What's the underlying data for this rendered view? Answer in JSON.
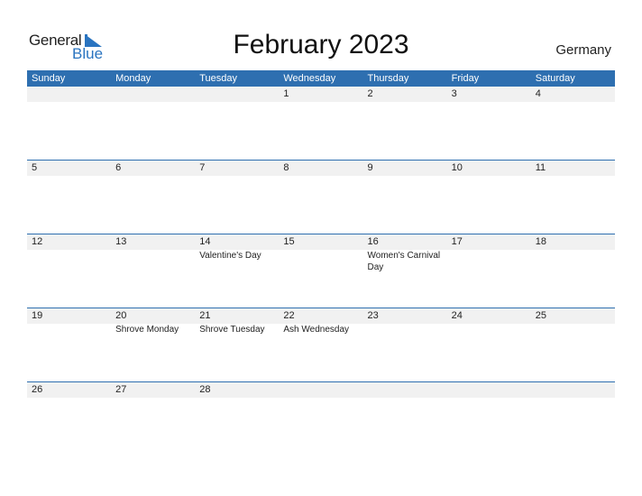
{
  "logo": {
    "word1": "General",
    "word2": "Blue",
    "brand_color": "#2a74c0"
  },
  "title": "February 2023",
  "country": "Germany",
  "header_color": "#2e6fb0",
  "weekdays": [
    "Sunday",
    "Monday",
    "Tuesday",
    "Wednesday",
    "Thursday",
    "Friday",
    "Saturday"
  ],
  "weeks": [
    {
      "days": [
        "",
        "",
        "",
        "1",
        "2",
        "3",
        "4"
      ],
      "events": [
        "",
        "",
        "",
        "",
        "",
        "",
        ""
      ]
    },
    {
      "days": [
        "5",
        "6",
        "7",
        "8",
        "9",
        "10",
        "11"
      ],
      "events": [
        "",
        "",
        "",
        "",
        "",
        "",
        ""
      ]
    },
    {
      "days": [
        "12",
        "13",
        "14",
        "15",
        "16",
        "17",
        "18"
      ],
      "events": [
        "",
        "",
        "Valentine's Day",
        "",
        "Women's Carnival Day",
        "",
        ""
      ]
    },
    {
      "days": [
        "19",
        "20",
        "21",
        "22",
        "23",
        "24",
        "25"
      ],
      "events": [
        "",
        "Shrove Monday",
        "Shrove Tuesday",
        "Ash Wednesday",
        "",
        "",
        ""
      ]
    },
    {
      "days": [
        "26",
        "27",
        "28",
        "",
        "",
        "",
        ""
      ],
      "events": [
        "",
        "",
        "",
        "",
        "",
        "",
        ""
      ]
    }
  ]
}
